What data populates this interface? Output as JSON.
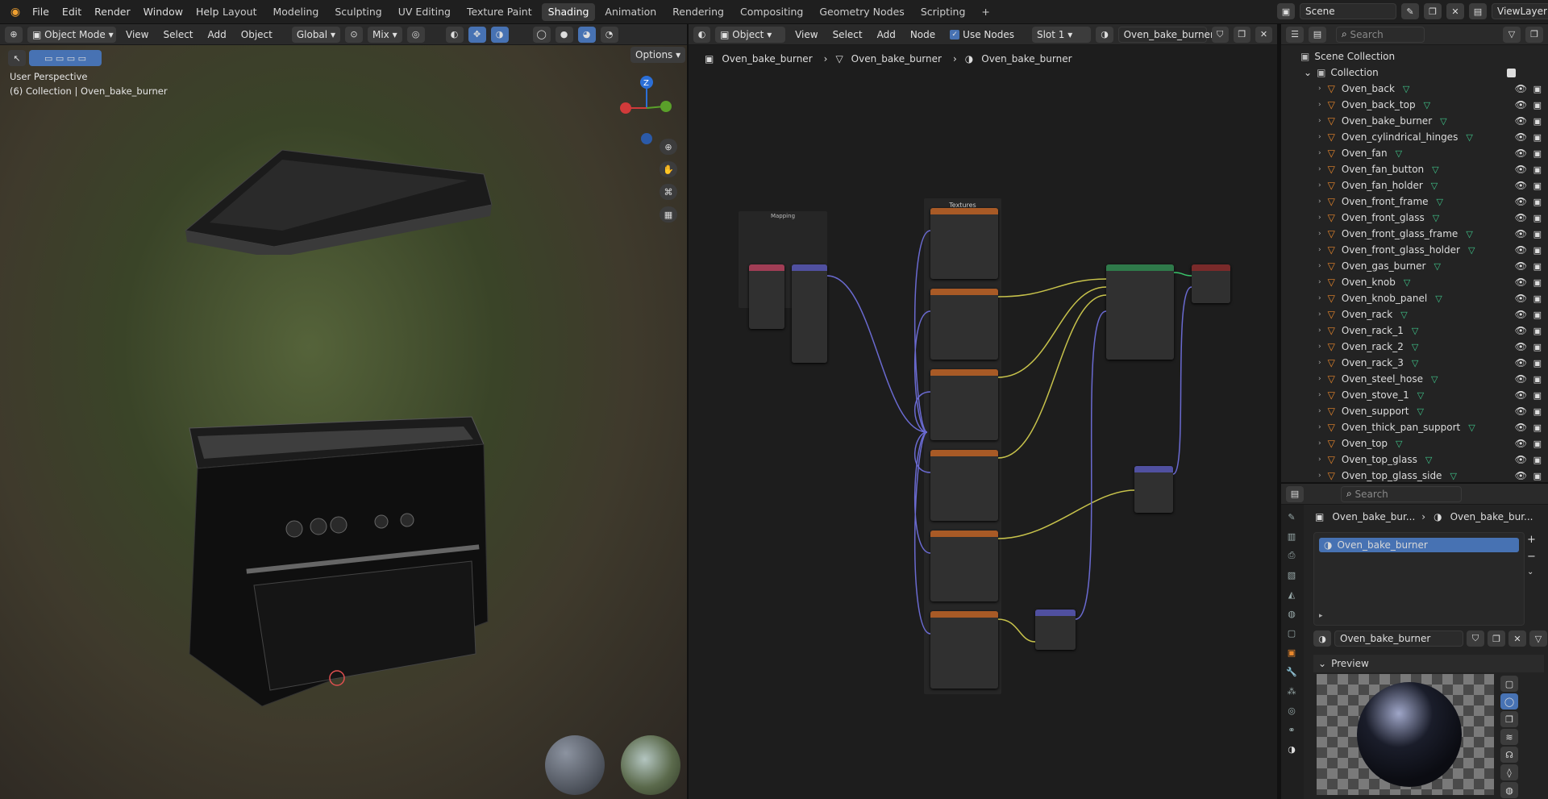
{
  "menu": {
    "items": [
      "File",
      "Edit",
      "Render",
      "Window",
      "Help"
    ]
  },
  "workspaces": {
    "tabs": [
      "Layout",
      "Modeling",
      "Sculpting",
      "UV Editing",
      "Texture Paint",
      "Shading",
      "Animation",
      "Rendering",
      "Compositing",
      "Geometry Nodes",
      "Scripting"
    ],
    "active": "Shading",
    "add": "+"
  },
  "scene": {
    "name": "Scene",
    "view_layer": "ViewLayer"
  },
  "viewport": {
    "mode": "Object Mode",
    "menus": [
      "View",
      "Select",
      "Add",
      "Object"
    ],
    "transform": "Global",
    "mix": "Mix",
    "options": "Options",
    "overlay_title": "User Perspective",
    "overlay_sub": "(6) Collection | Oven_bake_burner",
    "gizmo_z": "Z"
  },
  "node_editor": {
    "type": "Object",
    "menus": [
      "View",
      "Select",
      "Add",
      "Node"
    ],
    "use_nodes": "Use Nodes",
    "slot": "Slot 1",
    "material": "Oven_bake_burner",
    "breadcrumb": [
      "Oven_bake_burner",
      "Oven_bake_burner",
      "Oven_bake_burner"
    ],
    "frames": {
      "textures": "Textures",
      "mapping": "Mapping"
    }
  },
  "outliner": {
    "search_placeholder": "Search",
    "scene_collection": "Scene Collection",
    "collection": "Collection",
    "items": [
      "Oven_back",
      "Oven_back_top",
      "Oven_bake_burner",
      "Oven_cylindrical_hinges",
      "Oven_fan",
      "Oven_fan_button",
      "Oven_fan_holder",
      "Oven_front_frame",
      "Oven_front_glass",
      "Oven_front_glass_frame",
      "Oven_front_glass_holder",
      "Oven_gas_burner",
      "Oven_knob",
      "Oven_knob_panel",
      "Oven_rack",
      "Oven_rack_1",
      "Oven_rack_2",
      "Oven_rack_3",
      "Oven_steel_hose",
      "Oven_stove_1",
      "Oven_support",
      "Oven_thick_pan_support",
      "Oven_top",
      "Oven_top_glass",
      "Oven_top_glass_side"
    ]
  },
  "properties": {
    "search_placeholder": "Search",
    "breadcrumb": [
      "Oven_bake_bur...",
      "Oven_bake_bur..."
    ],
    "slot_item": "Oven_bake_burner",
    "material_name": "Oven_bake_burner",
    "preview_label": "Preview"
  },
  "colors": {
    "accent": "#4772b3",
    "orange": "#e8872c",
    "shader_yellow": "#c7c24b",
    "vector_purple": "#6363c7"
  }
}
